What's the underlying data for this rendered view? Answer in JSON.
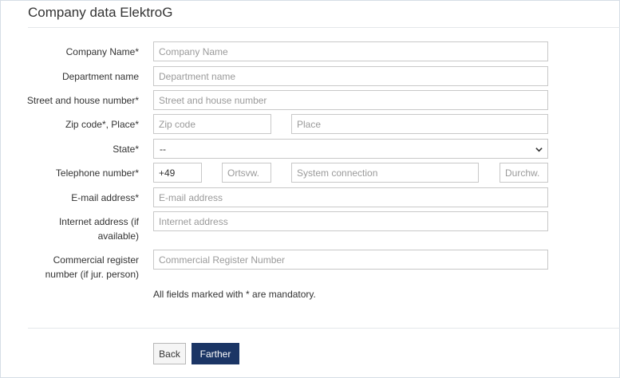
{
  "page": {
    "title": "Company data ElektroG"
  },
  "form": {
    "company_name": {
      "label": "Company Name*",
      "placeholder": "Company Name"
    },
    "department": {
      "label": "Department name",
      "placeholder": "Department name"
    },
    "street": {
      "label": "Street and house number*",
      "placeholder": "Street and house number"
    },
    "zip_place": {
      "label": "Zip code*, Place*",
      "zip_placeholder": "Zip code",
      "place_placeholder": "Place"
    },
    "state": {
      "label": "State*",
      "value": "--"
    },
    "telephone": {
      "label": "Telephone number*",
      "country_code": "+49",
      "area_placeholder": "Ortsvw.",
      "system_placeholder": "System connection",
      "extension_placeholder": "Durchw."
    },
    "email": {
      "label": "E-mail address*",
      "placeholder": "E-mail address"
    },
    "internet": {
      "label_line1": "Internet address (if",
      "label_line2": "available)",
      "placeholder": "Internet address"
    },
    "register": {
      "label_line1": "Commercial register",
      "label_line2": "number (if jur. person)",
      "placeholder": "Commercial Register Number"
    },
    "mandatory_note": "All fields marked with * are mandatory."
  },
  "buttons": {
    "back": "Back",
    "farther": "Farther"
  }
}
